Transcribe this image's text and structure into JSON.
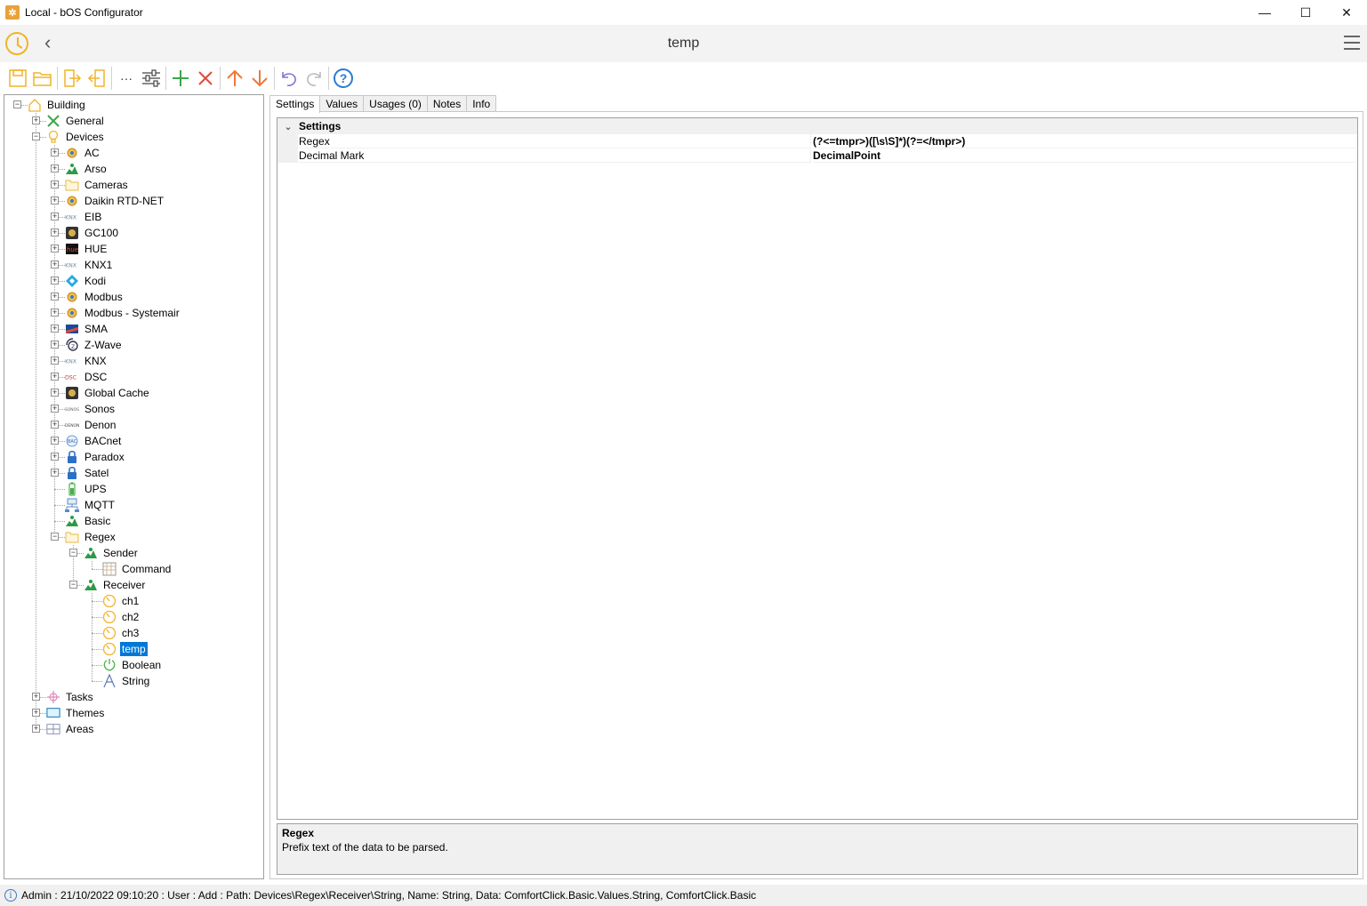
{
  "window": {
    "title": "Local - bOS Configurator",
    "icon": "gear-icon",
    "minimize": "—",
    "maximize": "☐",
    "close": "✕"
  },
  "header": {
    "title": "temp",
    "back_glyph": "‹"
  },
  "toolbar": {
    "more_glyph": "···",
    "help_glyph": "?"
  },
  "tree": [
    {
      "label": "Building",
      "depth": 0,
      "expander": "-",
      "icon": "building-icon"
    },
    {
      "label": "General",
      "depth": 1,
      "expander": "+",
      "icon": "tools-icon"
    },
    {
      "label": "Devices",
      "depth": 1,
      "expander": "-",
      "icon": "bulb-icon"
    },
    {
      "label": "AC",
      "depth": 2,
      "expander": "+",
      "icon": "device-icon"
    },
    {
      "label": "Arso",
      "depth": 2,
      "expander": "+",
      "icon": "green-device-icon"
    },
    {
      "label": "Cameras",
      "depth": 2,
      "expander": "+",
      "icon": "folder-icon"
    },
    {
      "label": "Daikin RTD-NET",
      "depth": 2,
      "expander": "+",
      "icon": "device-icon"
    },
    {
      "label": "EIB",
      "depth": 2,
      "expander": "+",
      "icon": "knx-icon"
    },
    {
      "label": "GC100",
      "depth": 2,
      "expander": "+",
      "icon": "gc-icon"
    },
    {
      "label": "HUE",
      "depth": 2,
      "expander": "+",
      "icon": "hue-icon"
    },
    {
      "label": "KNX1",
      "depth": 2,
      "expander": "+",
      "icon": "knx-icon"
    },
    {
      "label": "Kodi",
      "depth": 2,
      "expander": "+",
      "icon": "kodi-icon"
    },
    {
      "label": "Modbus",
      "depth": 2,
      "expander": "+",
      "icon": "device-icon"
    },
    {
      "label": "Modbus - Systemair",
      "depth": 2,
      "expander": "+",
      "icon": "device-icon"
    },
    {
      "label": "SMA",
      "depth": 2,
      "expander": "+",
      "icon": "sma-icon"
    },
    {
      "label": "Z-Wave",
      "depth": 2,
      "expander": "+",
      "icon": "zwave-icon"
    },
    {
      "label": "KNX",
      "depth": 2,
      "expander": "+",
      "icon": "knx-icon"
    },
    {
      "label": "DSC",
      "depth": 2,
      "expander": "+",
      "icon": "dsc-icon"
    },
    {
      "label": "Global Cache",
      "depth": 2,
      "expander": "+",
      "icon": "gc-icon"
    },
    {
      "label": "Sonos",
      "depth": 2,
      "expander": "+",
      "icon": "sonos-icon"
    },
    {
      "label": "Denon",
      "depth": 2,
      "expander": "+",
      "icon": "denon-icon"
    },
    {
      "label": "BACnet",
      "depth": 2,
      "expander": "+",
      "icon": "bacnet-icon"
    },
    {
      "label": "Paradox",
      "depth": 2,
      "expander": "+",
      "icon": "lock-icon"
    },
    {
      "label": "Satel",
      "depth": 2,
      "expander": "+",
      "icon": "lock-icon"
    },
    {
      "label": "UPS",
      "depth": 2,
      "expander": "",
      "icon": "battery-icon"
    },
    {
      "label": "MQTT",
      "depth": 2,
      "expander": "",
      "icon": "network-icon"
    },
    {
      "label": "Basic",
      "depth": 2,
      "expander": "",
      "icon": "green-device-icon"
    },
    {
      "label": "Regex",
      "depth": 2,
      "expander": "-",
      "icon": "folder-icon"
    },
    {
      "label": "Sender",
      "depth": 3,
      "expander": "-",
      "icon": "green-device-icon"
    },
    {
      "label": "Command",
      "depth": 4,
      "expander": "",
      "icon": "grid-icon"
    },
    {
      "label": "Receiver",
      "depth": 3,
      "expander": "-",
      "icon": "green-device-icon"
    },
    {
      "label": "ch1",
      "depth": 4,
      "expander": "",
      "icon": "gauge-icon"
    },
    {
      "label": "ch2",
      "depth": 4,
      "expander": "",
      "icon": "gauge-icon"
    },
    {
      "label": "ch3",
      "depth": 4,
      "expander": "",
      "icon": "gauge-icon"
    },
    {
      "label": "temp",
      "depth": 4,
      "expander": "",
      "icon": "gauge-icon",
      "selected": true
    },
    {
      "label": "Boolean",
      "depth": 4,
      "expander": "",
      "icon": "power-icon"
    },
    {
      "label": "String",
      "depth": 4,
      "expander": "",
      "icon": "string-icon"
    },
    {
      "label": "Tasks",
      "depth": 1,
      "expander": "+",
      "icon": "tasks-icon"
    },
    {
      "label": "Themes",
      "depth": 1,
      "expander": "+",
      "icon": "monitor-icon"
    },
    {
      "label": "Areas",
      "depth": 1,
      "expander": "+",
      "icon": "areas-icon"
    }
  ],
  "tabs": [
    "Settings",
    "Values",
    "Usages (0)",
    "Notes",
    "Info"
  ],
  "properties": {
    "category": "Settings",
    "rows": [
      {
        "name": "Regex",
        "value": "(?<=tmpr>)([\\s\\S]*)(?=</tmpr>)"
      },
      {
        "name": "Decimal Mark",
        "value": "DecimalPoint"
      }
    ]
  },
  "description": {
    "title": "Regex",
    "text": "Prefix text of the data to be parsed."
  },
  "status": {
    "icon": "info-icon",
    "text": "Admin : 21/10/2022 09:10:20 : User : Add : Path: Devices\\Regex\\Receiver\\String, Name: String, Data: ComfortClick.Basic.Values.String, ComfortClick.Basic"
  }
}
